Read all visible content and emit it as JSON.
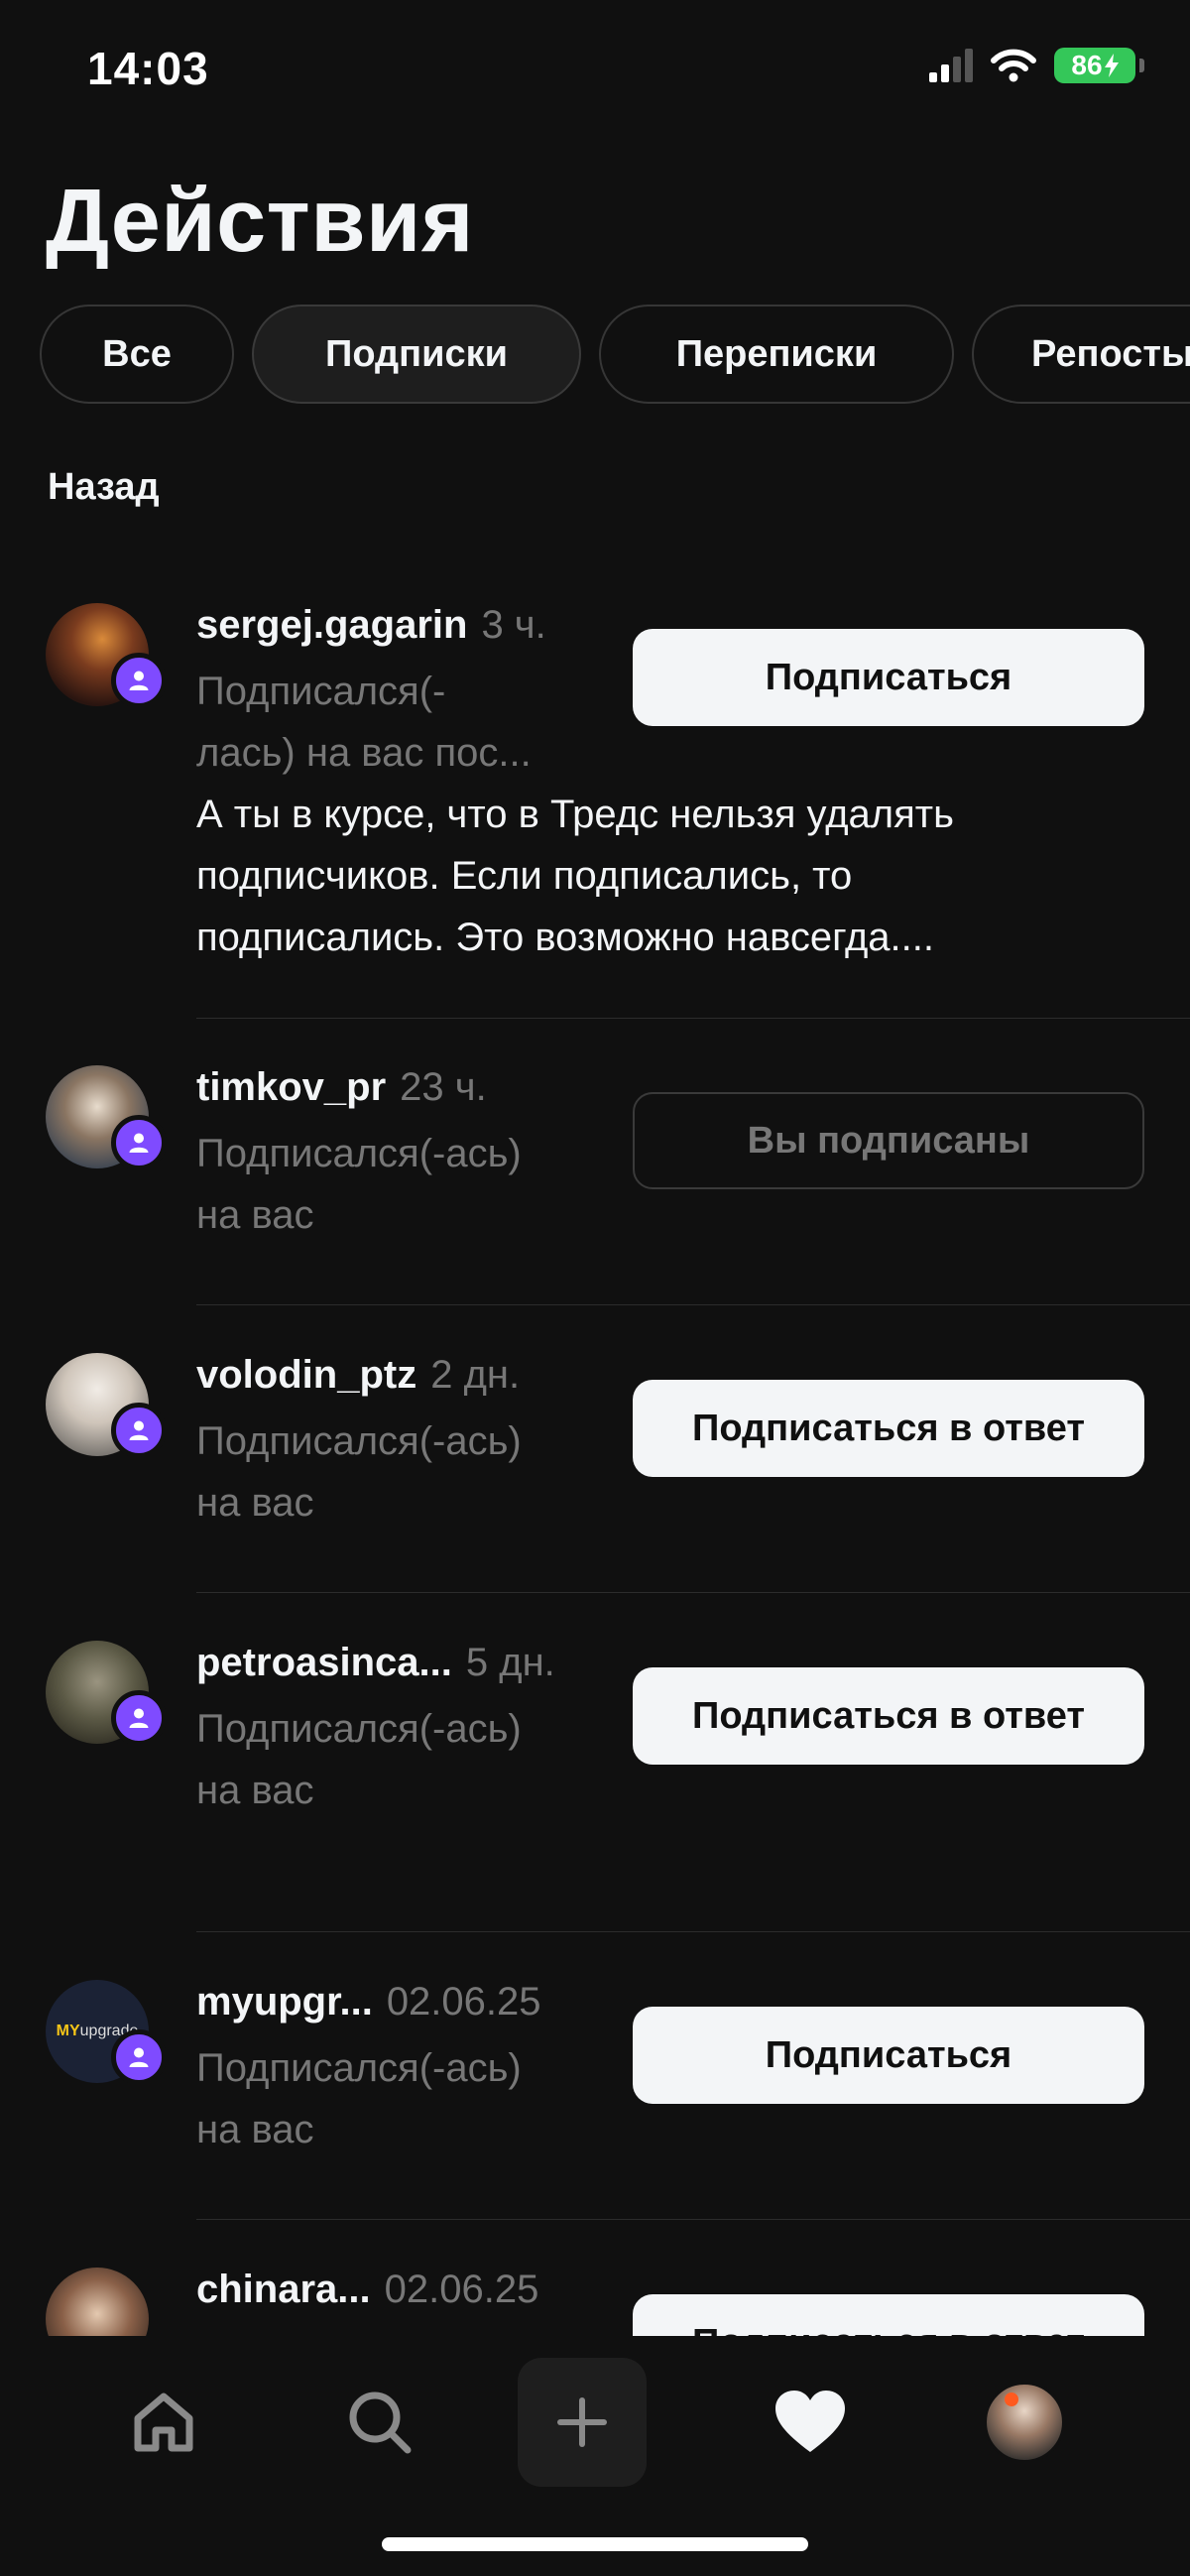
{
  "status_bar": {
    "time": "14:03",
    "battery": "86"
  },
  "page_title": "Действия",
  "tabs": [
    {
      "label": "Все",
      "active": false
    },
    {
      "label": "Подписки",
      "active": true
    },
    {
      "label": "Переписки",
      "active": false
    },
    {
      "label": "Репосты",
      "active": false
    }
  ],
  "section_label": "Назад",
  "items": [
    {
      "username": "sergej.gagarin",
      "time": "3 ч.",
      "action_lines": [
        "Подписался(-",
        "лась) на вас пос..."
      ],
      "note_lines": [
        "А ты в курсе, что в Тредс нельзя удалять",
        "подписчиков. Если подписались, то",
        "подписались. Это возможно навсегда...."
      ],
      "button": "Подписаться"
    },
    {
      "username": "timkov_pr",
      "time": "23 ч.",
      "action_lines": [
        "Подписался(-ась)",
        "на вас"
      ],
      "button": "Вы подписаны"
    },
    {
      "username": "volodin_ptz",
      "time": "2 дн.",
      "action_lines": [
        "Подписался(-ась)",
        "на вас"
      ],
      "button": "Подписаться в ответ"
    },
    {
      "username": "petroasinca...",
      "time": "5 дн.",
      "action_lines": [
        "Подписался(-ась)",
        "на вас"
      ],
      "button": "Подписаться в ответ"
    },
    {
      "username": "myupgr...",
      "time": "02.06.25",
      "action_lines": [
        "Подписался(-ась)",
        "на вас"
      ],
      "button": "Подписаться",
      "avatar_logo": {
        "bold": "MY",
        "rest": "upgrade"
      }
    },
    {
      "username": "chinara...",
      "time": "02.06.25",
      "button": "Подписаться в ответ"
    }
  ],
  "nav": [
    "home-icon",
    "search-icon",
    "plus-icon",
    "heart-icon",
    "profile-avatar"
  ],
  "colors": {
    "accent": "#7f4bff",
    "background": "#101010",
    "battery": "#34c759"
  }
}
